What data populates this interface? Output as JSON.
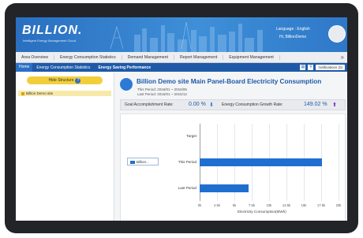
{
  "header": {
    "logo": "BILLION.",
    "tagline": "Intelligent Energy Management Cloud",
    "language_label": "Language : English",
    "user_label": "Hi, BillionDemo"
  },
  "topnav": {
    "items": [
      "Area Overview",
      "Energy Consumption Statistics",
      "Demand Management",
      "Report Management",
      "Equipment Management"
    ],
    "more": "»"
  },
  "subbar": {
    "home": "Home",
    "crumb1": "Energy Consumption Statistics",
    "crumb2": "Energy Saving Performance",
    "notifications": "notifications (0)"
  },
  "left": {
    "button": "Hide Structure",
    "site": "Billion Demo site"
  },
  "main": {
    "title": "Billion Demo site Main Panel-Board Electricity Consumption",
    "this_period": "This Period: 2016/01 ~ 2016/06",
    "last_period": "Last Period: 2015/01 ~ 2015/12",
    "goal_label": "Goal Accomplishment Rate:",
    "goal_value": "0.00 %",
    "growth_label": "Energy Consumption Growth Rate:",
    "growth_value": "149.02 %"
  },
  "chart_data": {
    "type": "bar",
    "orientation": "horizontal",
    "categories": [
      "Target",
      "This Period",
      "Last Period"
    ],
    "series": [
      {
        "name": "Billion...",
        "values": [
          0,
          17.6,
          7.1
        ]
      }
    ],
    "xlabel": "Electricity Consumption(MWh)",
    "xlim": [
      0,
      20
    ],
    "xticks": [
      "0k",
      "2.5k",
      "5k",
      "7.5k",
      "10k",
      "12.5k",
      "15k",
      "17.5k",
      "20k"
    ],
    "grid": true,
    "legend": "left",
    "color": "#1f6fd1"
  }
}
